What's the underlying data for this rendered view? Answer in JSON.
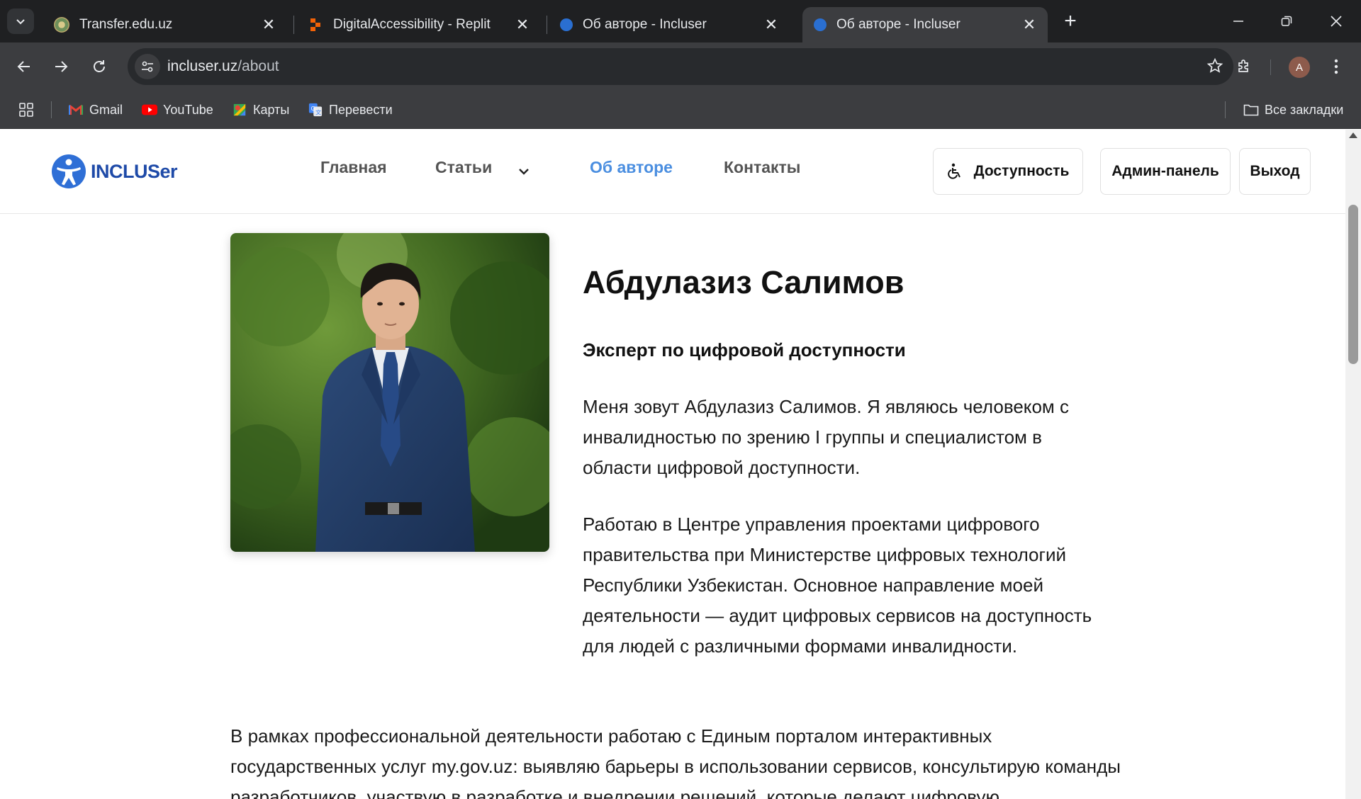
{
  "browser": {
    "tabs": [
      {
        "title": "Transfer.edu.uz",
        "active": false
      },
      {
        "title": "DigitalAccessibility - Replit",
        "active": false
      },
      {
        "title": "Об авторе - Incluser",
        "active": false
      },
      {
        "title": "Об авторе - Incluser",
        "active": true
      }
    ],
    "url_host": "incluser.uz",
    "url_path": "/about",
    "profile_initial": "A",
    "bookmarks": [
      {
        "label": "Gmail",
        "icon": "gmail-icon"
      },
      {
        "label": "YouTube",
        "icon": "youtube-icon"
      },
      {
        "label": "Карты",
        "icon": "maps-icon"
      },
      {
        "label": "Перевести",
        "icon": "translate-icon"
      }
    ],
    "all_bookmarks_label": "Все закладки"
  },
  "site": {
    "logo_text": "INCLUSer",
    "nav": [
      {
        "label": "Главная",
        "active": false
      },
      {
        "label": "Статьи",
        "active": false,
        "has_dropdown": true
      },
      {
        "label": "Об авторе",
        "active": true
      },
      {
        "label": "Контакты",
        "active": false
      }
    ],
    "buttons": {
      "accessibility": "Доступность",
      "admin": "Админ-панель",
      "logout": "Выход"
    },
    "colors": {
      "brand": "#1e4aa8",
      "nav_active": "#4a8ee0"
    }
  },
  "about": {
    "name": "Абдулазиз Салимов",
    "role": "Эксперт по цифровой доступности",
    "paragraphs": [
      "Меня зовут Абдулазиз Салимов. Я являюсь человеком с инвалидностью по зрению I группы и специалистом в области цифровой доступности.",
      "Работаю в Центре управления проектами цифрового правительства при Министерстве цифровых технологий Республики Узбекистан. Основное направление моей деятельности — аудит цифровых сервисов на доступность для людей с различными формами инвалидности.",
      "В рамках профессиональной деятельности работаю с Единым порталом интерактивных государственных услуг my.gov.uz: выявляю барьеры в использовании сервисов, консультирую команды разработчиков, участвую в разработке и внедрении решений, которые делают цифровую"
    ]
  }
}
